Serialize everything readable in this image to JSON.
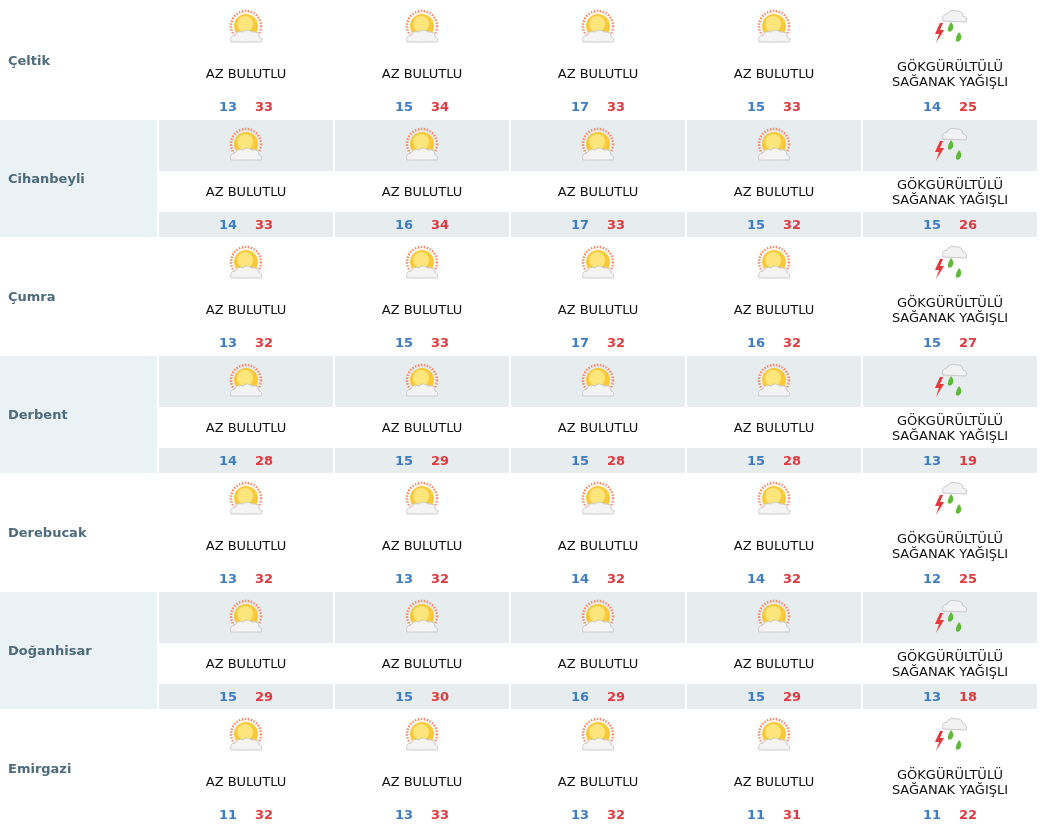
{
  "rows": [
    {
      "town": "Çeltik",
      "days": [
        {
          "kind": "partly_cloudy",
          "forecast": "AZ BULUTLU",
          "low": "13",
          "high": "33"
        },
        {
          "kind": "partly_cloudy",
          "forecast": "AZ BULUTLU",
          "low": "15",
          "high": "34"
        },
        {
          "kind": "partly_cloudy",
          "forecast": "AZ BULUTLU",
          "low": "17",
          "high": "33"
        },
        {
          "kind": "partly_cloudy",
          "forecast": "AZ BULUTLU",
          "low": "15",
          "high": "33"
        },
        {
          "kind": "thunderstorm",
          "forecast": "GÖKGÜRÜLTÜLÜ SAĞANAK YAĞIŞLI",
          "low": "14",
          "high": "25"
        }
      ]
    },
    {
      "town": "Cihanbeyli",
      "days": [
        {
          "kind": "partly_cloudy",
          "forecast": "AZ BULUTLU",
          "low": "14",
          "high": "33"
        },
        {
          "kind": "partly_cloudy",
          "forecast": "AZ BULUTLU",
          "low": "16",
          "high": "34"
        },
        {
          "kind": "partly_cloudy",
          "forecast": "AZ BULUTLU",
          "low": "17",
          "high": "33"
        },
        {
          "kind": "partly_cloudy",
          "forecast": "AZ BULUTLU",
          "low": "15",
          "high": "32"
        },
        {
          "kind": "thunderstorm",
          "forecast": "GÖKGÜRÜLTÜLÜ SAĞANAK YAĞIŞLI",
          "low": "15",
          "high": "26"
        }
      ]
    },
    {
      "town": "Çumra",
      "days": [
        {
          "kind": "partly_cloudy",
          "forecast": "AZ BULUTLU",
          "low": "13",
          "high": "32"
        },
        {
          "kind": "partly_cloudy",
          "forecast": "AZ BULUTLU",
          "low": "15",
          "high": "33"
        },
        {
          "kind": "partly_cloudy",
          "forecast": "AZ BULUTLU",
          "low": "17",
          "high": "32"
        },
        {
          "kind": "partly_cloudy",
          "forecast": "AZ BULUTLU",
          "low": "16",
          "high": "32"
        },
        {
          "kind": "thunderstorm",
          "forecast": "GÖKGÜRÜLTÜLÜ SAĞANAK YAĞIŞLI",
          "low": "15",
          "high": "27"
        }
      ]
    },
    {
      "town": "Derbent",
      "days": [
        {
          "kind": "partly_cloudy",
          "forecast": "AZ BULUTLU",
          "low": "14",
          "high": "28"
        },
        {
          "kind": "partly_cloudy",
          "forecast": "AZ BULUTLU",
          "low": "15",
          "high": "29"
        },
        {
          "kind": "partly_cloudy",
          "forecast": "AZ BULUTLU",
          "low": "15",
          "high": "28"
        },
        {
          "kind": "partly_cloudy",
          "forecast": "AZ BULUTLU",
          "low": "15",
          "high": "28"
        },
        {
          "kind": "thunderstorm",
          "forecast": "GÖKGÜRÜLTÜLÜ SAĞANAK YAĞIŞLI",
          "low": "13",
          "high": "19"
        }
      ]
    },
    {
      "town": "Derebucak",
      "days": [
        {
          "kind": "partly_cloudy",
          "forecast": "AZ BULUTLU",
          "low": "13",
          "high": "32"
        },
        {
          "kind": "partly_cloudy",
          "forecast": "AZ BULUTLU",
          "low": "13",
          "high": "32"
        },
        {
          "kind": "partly_cloudy",
          "forecast": "AZ BULUTLU",
          "low": "14",
          "high": "32"
        },
        {
          "kind": "partly_cloudy",
          "forecast": "AZ BULUTLU",
          "low": "14",
          "high": "32"
        },
        {
          "kind": "thunderstorm",
          "forecast": "GÖKGÜRÜLTÜLÜ SAĞANAK YAĞIŞLI",
          "low": "12",
          "high": "25"
        }
      ]
    },
    {
      "town": "Doğanhisar",
      "days": [
        {
          "kind": "partly_cloudy",
          "forecast": "AZ BULUTLU",
          "low": "15",
          "high": "29"
        },
        {
          "kind": "partly_cloudy",
          "forecast": "AZ BULUTLU",
          "low": "15",
          "high": "30"
        },
        {
          "kind": "partly_cloudy",
          "forecast": "AZ BULUTLU",
          "low": "16",
          "high": "29"
        },
        {
          "kind": "partly_cloudy",
          "forecast": "AZ BULUTLU",
          "low": "15",
          "high": "29"
        },
        {
          "kind": "thunderstorm",
          "forecast": "GÖKGÜRÜLTÜLÜ SAĞANAK YAĞIŞLI",
          "low": "13",
          "high": "18"
        }
      ]
    },
    {
      "town": "Emirgazi",
      "days": [
        {
          "kind": "partly_cloudy",
          "forecast": "AZ BULUTLU",
          "low": "11",
          "high": "32"
        },
        {
          "kind": "partly_cloudy",
          "forecast": "AZ BULUTLU",
          "low": "13",
          "high": "33"
        },
        {
          "kind": "partly_cloudy",
          "forecast": "AZ BULUTLU",
          "low": "13",
          "high": "32"
        },
        {
          "kind": "partly_cloudy",
          "forecast": "AZ BULUTLU",
          "low": "11",
          "high": "31"
        },
        {
          "kind": "thunderstorm",
          "forecast": "GÖKGÜRÜLTÜLÜ SAĞANAK YAĞIŞLI",
          "low": "11",
          "high": "22"
        }
      ]
    }
  ]
}
